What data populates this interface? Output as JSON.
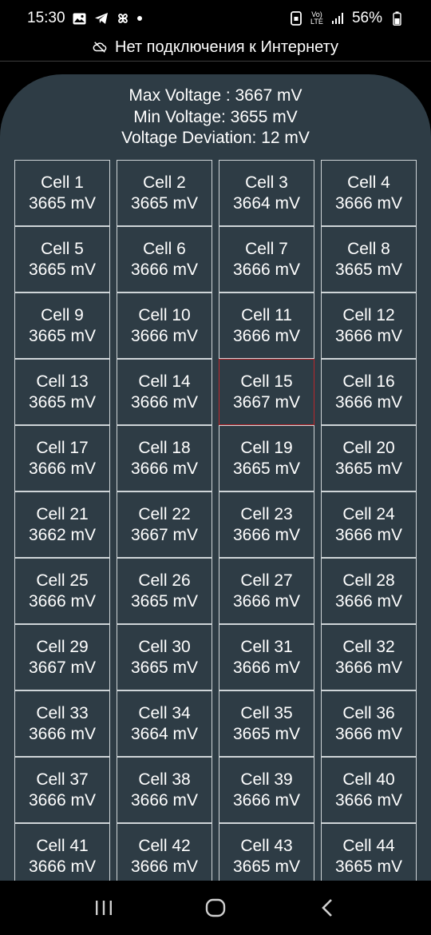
{
  "status_bar": {
    "time": "15:30",
    "battery": "56%",
    "network": "Vo) LTE"
  },
  "offline_banner": {
    "text": "Нет подключения к Интернету",
    "icon": "cloud-off-icon"
  },
  "summary": {
    "max": "Max Voltage : 3667 mV",
    "min": "Min Voltage: 3655 mV",
    "deviation": "Voltage Deviation: 12 mV"
  },
  "cells": [
    {
      "name": "Cell 1",
      "value": "3665 mV"
    },
    {
      "name": "Cell 2",
      "value": "3665 mV"
    },
    {
      "name": "Cell 3",
      "value": "3664 mV"
    },
    {
      "name": "Cell 4",
      "value": "3666 mV"
    },
    {
      "name": "Cell 5",
      "value": "3665 mV"
    },
    {
      "name": "Cell 6",
      "value": "3666 mV"
    },
    {
      "name": "Cell 7",
      "value": "3666 mV"
    },
    {
      "name": "Cell 8",
      "value": "3665 mV"
    },
    {
      "name": "Cell 9",
      "value": "3665 mV"
    },
    {
      "name": "Cell 10",
      "value": "3666 mV"
    },
    {
      "name": "Cell 11",
      "value": "3666 mV"
    },
    {
      "name": "Cell 12",
      "value": "3666 mV"
    },
    {
      "name": "Cell 13",
      "value": "3665 mV"
    },
    {
      "name": "Cell 14",
      "value": "3666 mV"
    },
    {
      "name": "Cell 15",
      "value": "3667 mV",
      "highlight": true
    },
    {
      "name": "Cell 16",
      "value": "3666 mV"
    },
    {
      "name": "Cell 17",
      "value": "3666 mV"
    },
    {
      "name": "Cell 18",
      "value": "3666 mV"
    },
    {
      "name": "Cell 19",
      "value": "3665 mV"
    },
    {
      "name": "Cell 20",
      "value": "3665 mV"
    },
    {
      "name": "Cell 21",
      "value": "3662 mV"
    },
    {
      "name": "Cell 22",
      "value": "3667 mV"
    },
    {
      "name": "Cell 23",
      "value": "3666 mV"
    },
    {
      "name": "Cell 24",
      "value": "3666 mV"
    },
    {
      "name": "Cell 25",
      "value": "3666 mV"
    },
    {
      "name": "Cell 26",
      "value": "3665 mV"
    },
    {
      "name": "Cell 27",
      "value": "3666 mV"
    },
    {
      "name": "Cell 28",
      "value": "3666 mV"
    },
    {
      "name": "Cell 29",
      "value": "3667 mV"
    },
    {
      "name": "Cell 30",
      "value": "3665 mV"
    },
    {
      "name": "Cell 31",
      "value": "3666 mV"
    },
    {
      "name": "Cell 32",
      "value": "3666 mV"
    },
    {
      "name": "Cell 33",
      "value": "3666 mV"
    },
    {
      "name": "Cell 34",
      "value": "3664 mV"
    },
    {
      "name": "Cell 35",
      "value": "3665 mV"
    },
    {
      "name": "Cell 36",
      "value": "3666 mV"
    },
    {
      "name": "Cell 37",
      "value": "3666 mV"
    },
    {
      "name": "Cell 38",
      "value": "3666 mV"
    },
    {
      "name": "Cell 39",
      "value": "3666 mV"
    },
    {
      "name": "Cell 40",
      "value": "3666 mV"
    },
    {
      "name": "Cell 41",
      "value": "3666 mV"
    },
    {
      "name": "Cell 42",
      "value": "3666 mV"
    },
    {
      "name": "Cell 43",
      "value": "3665 mV"
    },
    {
      "name": "Cell 44",
      "value": "3665 mV"
    }
  ],
  "colors": {
    "panel_bg": "#2e3c45",
    "cell_border": "#cfd5d8",
    "highlight_border": "#b8282c"
  },
  "nav": {
    "recents": "recents-icon",
    "home": "home-icon",
    "back": "back-icon"
  }
}
